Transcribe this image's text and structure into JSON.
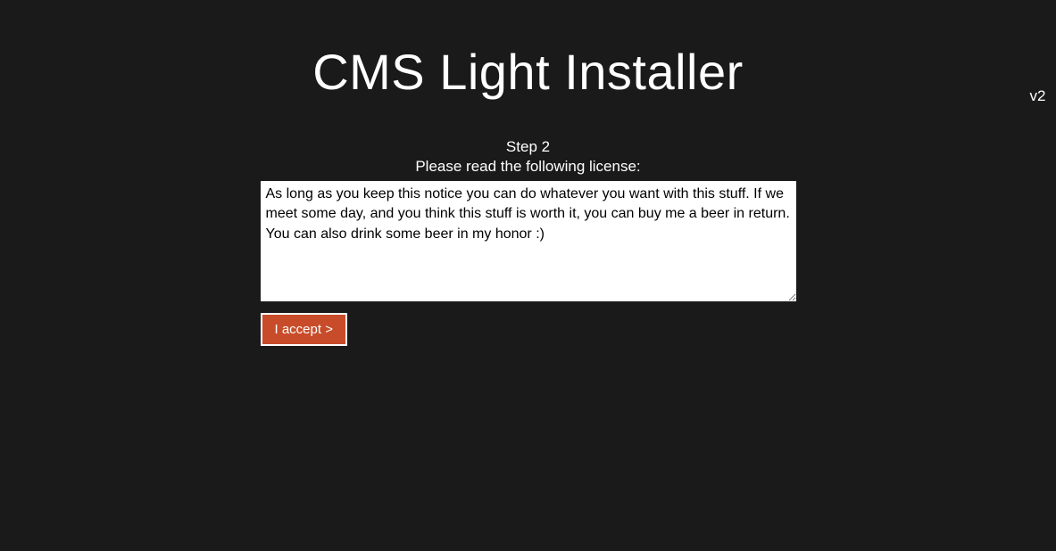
{
  "header": {
    "title": "CMS Light Installer",
    "version": "v2"
  },
  "step": {
    "label": "Step 2",
    "instruction": "Please read the following license:"
  },
  "license": {
    "text": "As long as you keep this notice you can do whatever you want with this stuff. If we meet some day, and you think this stuff is worth it, you can buy me a beer in return. You can also drink some beer in my honor :)"
  },
  "actions": {
    "accept_label": "I accept >"
  }
}
